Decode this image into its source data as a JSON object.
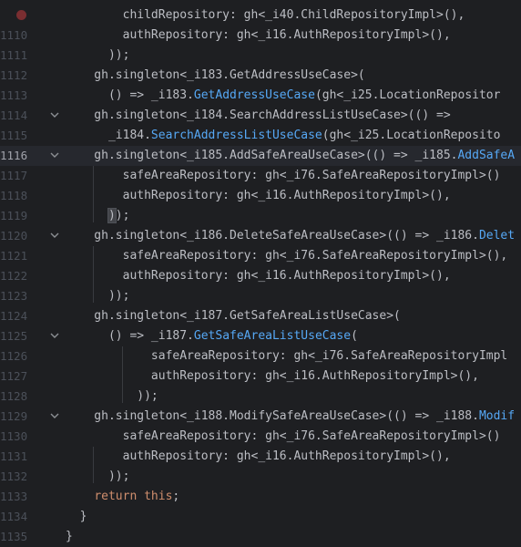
{
  "editor": {
    "lines": [
      {
        "num": "",
        "segments": [
          {
            "t": "        childRepository: gh<_i40.ChildRepositoryImpl>(),",
            "c": ""
          }
        ],
        "fold": false,
        "breakpoint": true
      },
      {
        "num": "1110",
        "segments": [
          {
            "t": "        authRepository: gh<_i16.AuthRepositoryImpl>(),",
            "c": ""
          }
        ],
        "fold": false
      },
      {
        "num": "1111",
        "segments": [
          {
            "t": "      ));",
            "c": ""
          }
        ],
        "fold": false
      },
      {
        "num": "1112",
        "segments": [
          {
            "t": "    gh.singleton<_i183.GetAddressUseCase>(",
            "c": ""
          }
        ],
        "fold": false
      },
      {
        "num": "1113",
        "segments": [
          {
            "t": "      () => _i183.",
            "c": ""
          },
          {
            "t": "GetAddressUseCase",
            "c": "fn"
          },
          {
            "t": "(gh<_i25.LocationRepositor",
            "c": ""
          }
        ],
        "fold": false
      },
      {
        "num": "1114",
        "segments": [
          {
            "t": "    gh.singleton<_i184.SearchAddressListUseCase>(() =>",
            "c": ""
          }
        ],
        "fold": true
      },
      {
        "num": "1115",
        "segments": [
          {
            "t": "      _i184.",
            "c": ""
          },
          {
            "t": "SearchAddressListUseCase",
            "c": "fn"
          },
          {
            "t": "(gh<_i25.LocationReposito",
            "c": ""
          }
        ],
        "fold": false
      },
      {
        "num": "1116",
        "segments": [
          {
            "t": "    gh.singleton<_i185.AddSafeAreaUseCase>(() => _i185.",
            "c": ""
          },
          {
            "t": "AddSafeA",
            "c": "fn"
          }
        ],
        "fold": true,
        "current": true
      },
      {
        "num": "1117",
        "segments": [
          {
            "t": "        safeAreaRepository: gh<_i76.SafeAreaRepositoryImpl>()",
            "c": ""
          }
        ],
        "fold": false
      },
      {
        "num": "1118",
        "segments": [
          {
            "t": "        authRepository: gh<_i16.AuthRepositoryImpl>(),",
            "c": ""
          }
        ],
        "fold": false
      },
      {
        "num": "1119",
        "segments": [
          {
            "t": "      ",
            "c": ""
          },
          {
            "t": ")",
            "c": "match"
          },
          {
            "t": ");",
            "c": ""
          }
        ],
        "fold": false
      },
      {
        "num": "1120",
        "segments": [
          {
            "t": "    gh.singleton<_i186.DeleteSafeAreaUseCase>(() => _i186.",
            "c": ""
          },
          {
            "t": "Delet",
            "c": "fn"
          }
        ],
        "fold": true
      },
      {
        "num": "1121",
        "segments": [
          {
            "t": "        safeAreaRepository: gh<_i76.SafeAreaRepositoryImpl>(),",
            "c": ""
          }
        ],
        "fold": false
      },
      {
        "num": "1122",
        "segments": [
          {
            "t": "        authRepository: gh<_i16.AuthRepositoryImpl>(),",
            "c": ""
          }
        ],
        "fold": false
      },
      {
        "num": "1123",
        "segments": [
          {
            "t": "      ));",
            "c": ""
          }
        ],
        "fold": false
      },
      {
        "num": "1124",
        "segments": [
          {
            "t": "    gh.singleton<_i187.GetSafeAreaListUseCase>(",
            "c": ""
          }
        ],
        "fold": false
      },
      {
        "num": "1125",
        "segments": [
          {
            "t": "      () => _i187.",
            "c": ""
          },
          {
            "t": "GetSafeAreaListUseCase",
            "c": "fn"
          },
          {
            "t": "(",
            "c": ""
          }
        ],
        "fold": true
      },
      {
        "num": "1126",
        "segments": [
          {
            "t": "            safeAreaRepository: gh<_i76.SafeAreaRepositoryImpl",
            "c": ""
          }
        ],
        "fold": false
      },
      {
        "num": "1127",
        "segments": [
          {
            "t": "            authRepository: gh<_i16.AuthRepositoryImpl>(),",
            "c": ""
          }
        ],
        "fold": false
      },
      {
        "num": "1128",
        "segments": [
          {
            "t": "          ));",
            "c": ""
          }
        ],
        "fold": false
      },
      {
        "num": "1129",
        "segments": [
          {
            "t": "    gh.singleton<_i188.ModifySafeAreaUseCase>(() => _i188.",
            "c": ""
          },
          {
            "t": "Modif",
            "c": "fn"
          }
        ],
        "fold": true
      },
      {
        "num": "1130",
        "segments": [
          {
            "t": "        safeAreaRepository: gh<_i76.SafeAreaRepositoryImpl>()",
            "c": ""
          }
        ],
        "fold": false
      },
      {
        "num": "1131",
        "segments": [
          {
            "t": "        authRepository: gh<_i16.AuthRepositoryImpl>(),",
            "c": ""
          }
        ],
        "fold": false
      },
      {
        "num": "1132",
        "segments": [
          {
            "t": "      ));",
            "c": ""
          }
        ],
        "fold": false
      },
      {
        "num": "1133",
        "segments": [
          {
            "t": "    ",
            "c": ""
          },
          {
            "t": "return",
            "c": "kw"
          },
          {
            "t": " ",
            "c": ""
          },
          {
            "t": "this",
            "c": "kw"
          },
          {
            "t": ";",
            "c": ""
          }
        ],
        "fold": false
      },
      {
        "num": "1134",
        "segments": [
          {
            "t": "  }",
            "c": ""
          }
        ],
        "fold": false
      },
      {
        "num": "1135",
        "segments": [
          {
            "t": "}",
            "c": ""
          }
        ],
        "fold": false
      }
    ],
    "colors": {
      "background": "#1e1f22",
      "text": "#bcbec4",
      "keyword": "#cf8e6d",
      "function": "#56a8f5",
      "line_number": "#4b5059",
      "current_line": "#26282e"
    },
    "icons": {
      "fold": "chevron-down-icon",
      "breakpoint": "breakpoint-icon"
    }
  }
}
